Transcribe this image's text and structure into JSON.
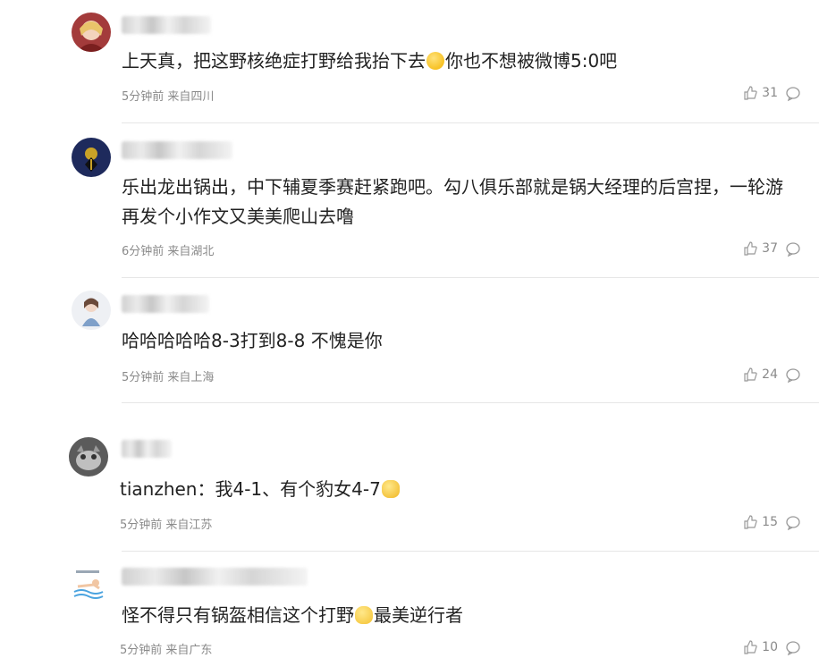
{
  "comments": [
    {
      "text": "上天真，把这野核绝症打野给我抬下去",
      "text_after": "你也不想被微博5:0吧",
      "emoji": "smile-emoji",
      "time": "5分钟前",
      "location": "来自四川",
      "likes": "31"
    },
    {
      "text": "乐出龙出锅出，中下辅夏季赛赶紧跑吧。勾八俱乐部就是锅大经理的后宫捏，一轮游再发个小作文又美美爬山去噜",
      "time": "6分钟前",
      "location": "来自湖北",
      "likes": "37"
    },
    {
      "text": "哈哈哈哈哈8-3打到8-8 不愧是你",
      "time": "5分钟前",
      "location": "来自上海",
      "likes": "24"
    },
    {
      "text": "tianzhen：我4-1、有个豹女4-7",
      "emoji": "thumb-emoji",
      "time": "5分钟前",
      "location": "来自江苏",
      "likes": "15"
    },
    {
      "text": "怪不得只有锅盔相信这个打野",
      "text_after": "最美逆行者",
      "emoji": "clap-emoji",
      "time": "5分钟前",
      "location": "来自广东",
      "likes": "10"
    }
  ],
  "colors": {
    "text": "#222222",
    "meta": "#8a8a8a",
    "divider": "#e6e6e6"
  }
}
